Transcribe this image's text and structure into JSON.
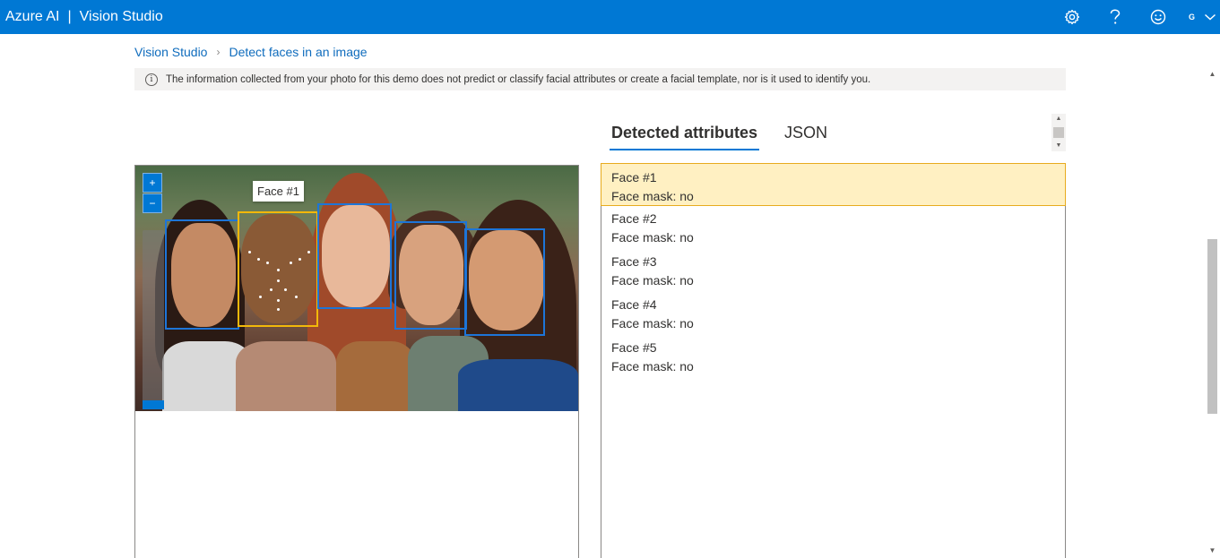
{
  "header": {
    "brand_primary": "Azure AI",
    "brand_separator": "|",
    "brand_product": "Vision Studio",
    "account_initial": "G",
    "icons": [
      "gear-icon",
      "help-icon",
      "feedback-smiley-icon",
      "chevron-down-icon"
    ]
  },
  "breadcrumb": {
    "items": [
      "Vision Studio",
      "Detect faces in an image"
    ],
    "separator": "›"
  },
  "info_banner": {
    "icon": "info-icon",
    "text": "The information collected from your photo for this demo does not predict or classify facial attributes or create a facial template, nor is it used to identify you."
  },
  "image_viewer": {
    "zoom_in": "+",
    "zoom_out": "−",
    "tooltip": "Face #1"
  },
  "tabs": [
    {
      "label": "Detected attributes",
      "active": true
    },
    {
      "label": "JSON",
      "active": false
    }
  ],
  "faces": [
    {
      "title": "Face #1",
      "attribute": "Face mask: no",
      "selected": true
    },
    {
      "title": "Face #2",
      "attribute": "Face mask: no",
      "selected": false
    },
    {
      "title": "Face #3",
      "attribute": "Face mask: no",
      "selected": false
    },
    {
      "title": "Face #4",
      "attribute": "Face mask: no",
      "selected": false
    },
    {
      "title": "Face #5",
      "attribute": "Face mask: no",
      "selected": false
    }
  ],
  "colors": {
    "brand": "#0078d4",
    "face_box": "#1d75d8",
    "selected_face_box": "#f2b80a",
    "selected_row": "#fff0c2"
  }
}
